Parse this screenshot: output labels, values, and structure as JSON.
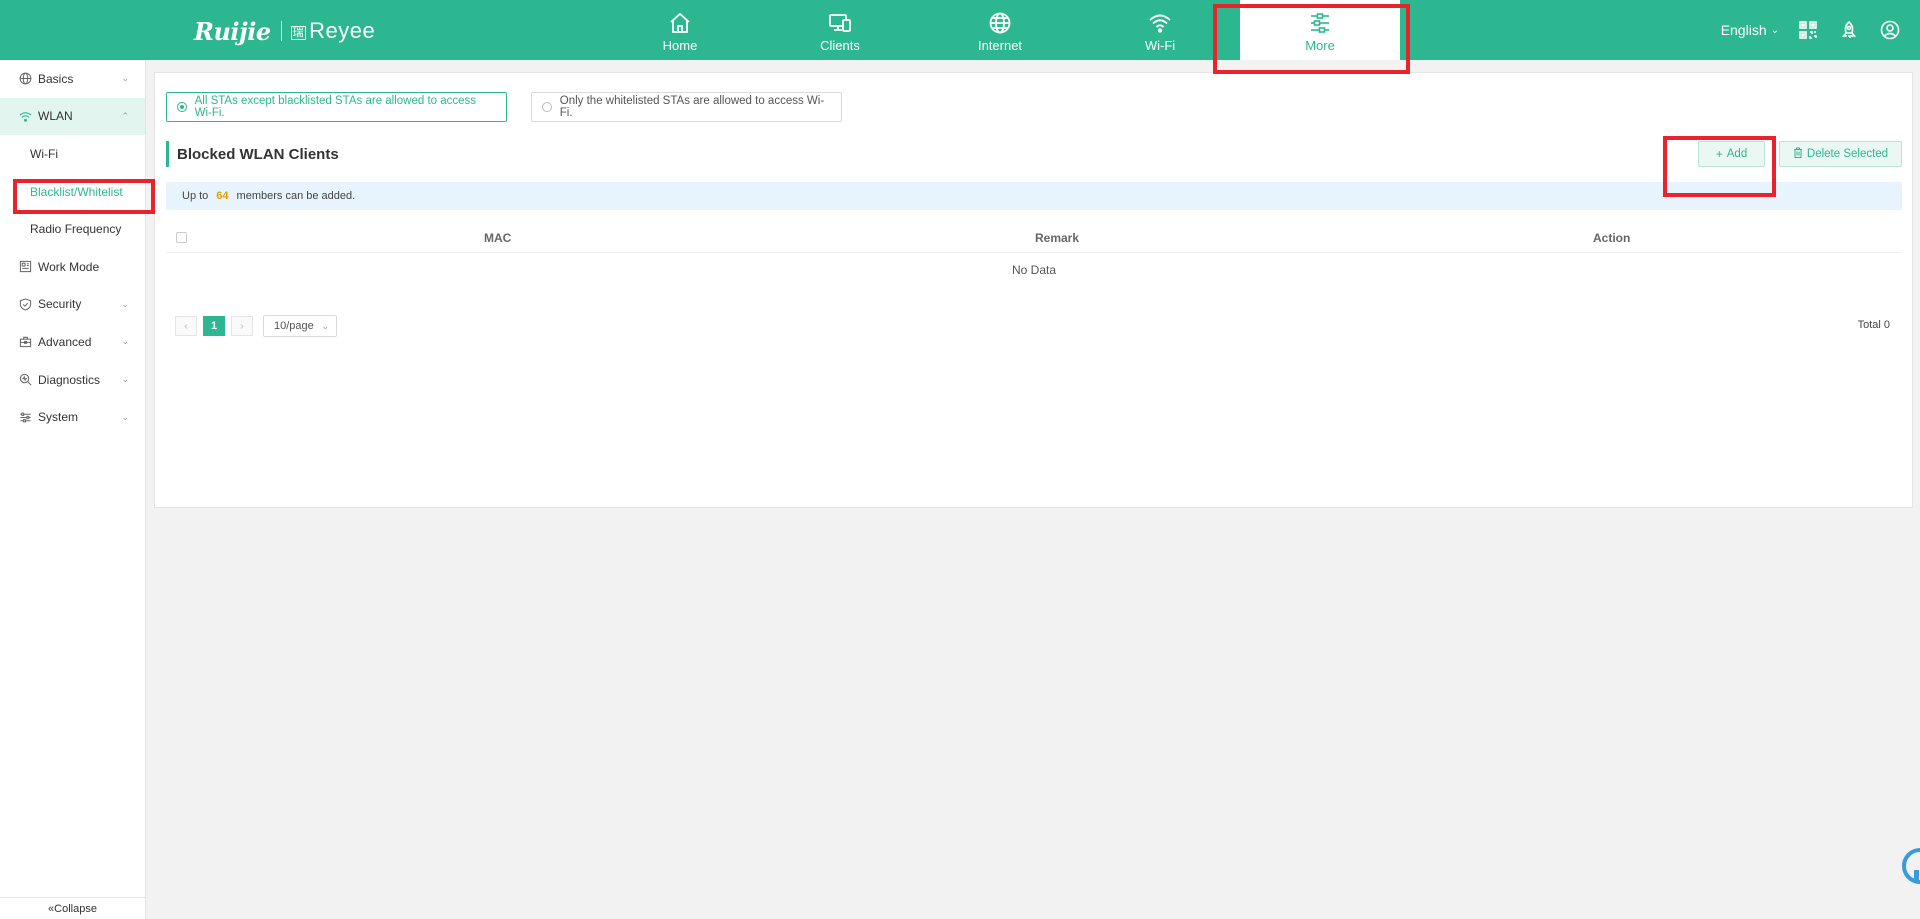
{
  "header": {
    "logo_brand": "Ruijie",
    "logo_product": "Reyee",
    "nav": [
      {
        "label": "Home",
        "icon": "home-icon"
      },
      {
        "label": "Clients",
        "icon": "clients-icon"
      },
      {
        "label": "Internet",
        "icon": "globe-icon"
      },
      {
        "label": "Wi-Fi",
        "icon": "wifi-icon"
      },
      {
        "label": "More",
        "icon": "more-icon",
        "active": true
      }
    ],
    "language": "English",
    "colors": {
      "brand": "#2db791",
      "highlight": "#e8232b",
      "count": "#e0a100"
    }
  },
  "sidebar": {
    "items": [
      {
        "label": "Basics",
        "icon": "globe-icon"
      },
      {
        "label": "WLAN",
        "icon": "wifi-icon",
        "expanded": true
      },
      {
        "label": "Wi-Fi"
      },
      {
        "label": "Blacklist/Whitelist",
        "active": true
      },
      {
        "label": "Radio Frequency"
      },
      {
        "label": "Work Mode",
        "icon": "work-mode-icon"
      },
      {
        "label": "Security",
        "icon": "shield-icon"
      },
      {
        "label": "Advanced",
        "icon": "toolbox-icon"
      },
      {
        "label": "Diagnostics",
        "icon": "diagnostics-icon"
      },
      {
        "label": "System",
        "icon": "sliders-icon"
      }
    ],
    "collapse_label": "Collapse"
  },
  "main": {
    "mode_options": [
      {
        "label": "All STAs except blacklisted STAs are allowed to access Wi-Fi.",
        "selected": true
      },
      {
        "label": "Only the whitelisted STAs are allowed to access Wi-Fi.",
        "selected": false
      }
    ],
    "section_title": "Blocked WLAN Clients",
    "add_label": "Add",
    "delete_label": "Delete Selected",
    "notice": {
      "prefix": "Up to",
      "count": "64",
      "suffix": "members can be added."
    },
    "table": {
      "columns": [
        "MAC",
        "Remark",
        "Action"
      ],
      "empty_text": "No Data"
    },
    "pagination": {
      "current_page": "1",
      "page_size": "10/page",
      "total": "Total 0"
    }
  }
}
